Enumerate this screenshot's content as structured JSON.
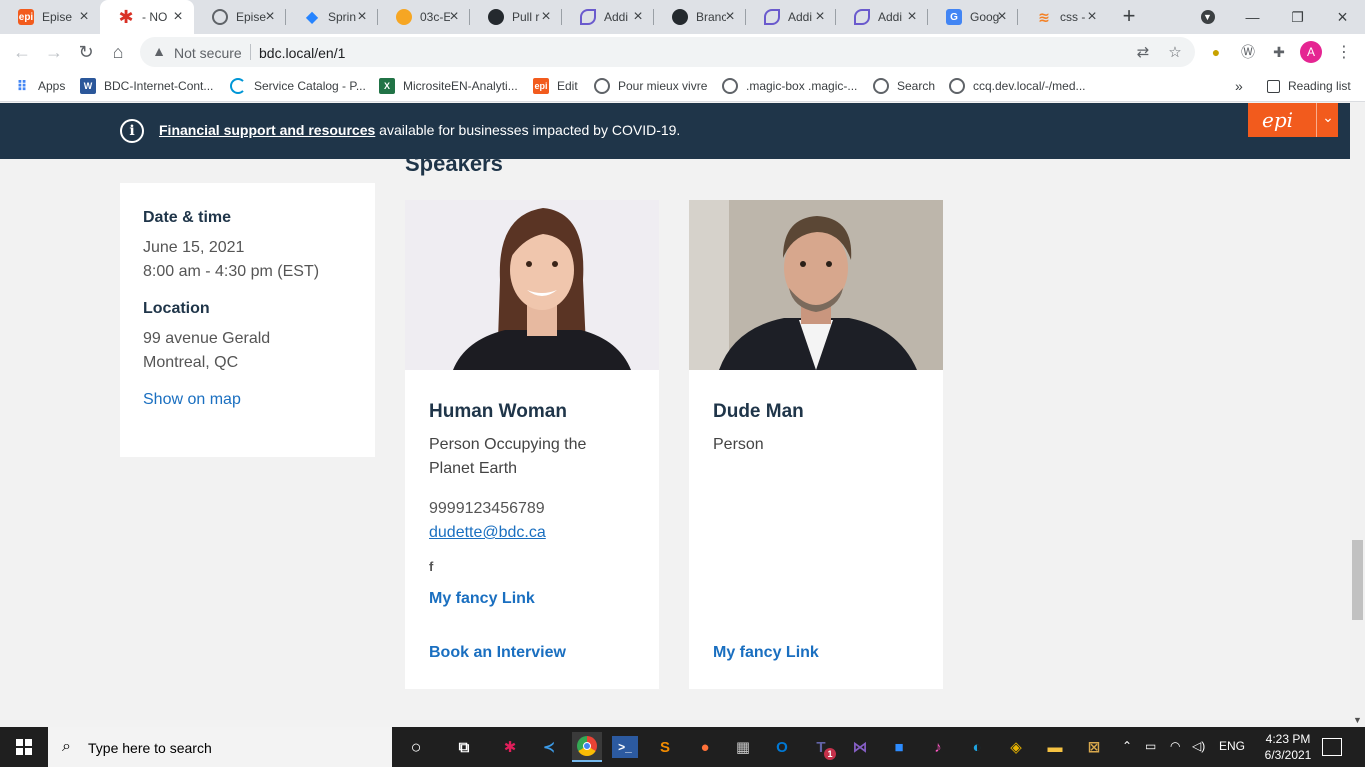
{
  "tabs": [
    {
      "label": "Epise",
      "fav_color": "#f25b1d",
      "fav_glyph": "epi"
    },
    {
      "label": "- NO",
      "fav_color": "#d93025",
      "fav_glyph": "*",
      "active": true
    },
    {
      "label": "Epise",
      "fav_color": "#5f6368",
      "fav_glyph": "globe"
    },
    {
      "label": "Sprin",
      "fav_color": "#2684ff",
      "fav_glyph": "diamond"
    },
    {
      "label": "03c-E",
      "fav_color": "#f6a623",
      "fav_glyph": "cloud"
    },
    {
      "label": "Pull r",
      "fav_color": "#24292e",
      "fav_glyph": "github"
    },
    {
      "label": "Addi",
      "fav_color": "#6a5acd",
      "fav_glyph": "swirl"
    },
    {
      "label": "Branc",
      "fav_color": "#24292e",
      "fav_glyph": "github"
    },
    {
      "label": "Addi",
      "fav_color": "#6a5acd",
      "fav_glyph": "swirl"
    },
    {
      "label": "Addi",
      "fav_color": "#6a5acd",
      "fav_glyph": "swirl"
    },
    {
      "label": "Goog",
      "fav_color": "#4285f4",
      "fav_glyph": "G"
    },
    {
      "label": "css -",
      "fav_color": "#f48024",
      "fav_glyph": "stack"
    }
  ],
  "toolbar": {
    "security_text": "Not secure",
    "url": "bdc.local/en/1",
    "avatar_letter": "A"
  },
  "bookmarks": [
    {
      "label": "Apps",
      "icon_color": "#4285f4",
      "glyph": "grid"
    },
    {
      "label": "BDC-Internet-Cont...",
      "icon_color": "#2b579a",
      "glyph": "W"
    },
    {
      "label": "Service Catalog - P...",
      "icon_color": "#0096d6",
      "glyph": "C"
    },
    {
      "label": "MicrositeEN-Analyti...",
      "icon_color": "#217346",
      "glyph": "X"
    },
    {
      "label": "Edit",
      "icon_color": "#f25b1d",
      "glyph": "epi"
    },
    {
      "label": "Pour mieux vivre",
      "icon_color": "#5f6368",
      "glyph": "globe"
    },
    {
      "label": ".magic-box .magic-...",
      "icon_color": "#5f6368",
      "glyph": "globe"
    },
    {
      "label": "Search",
      "icon_color": "#5f6368",
      "glyph": "globe"
    },
    {
      "label": "ccq.dev.local/-/med...",
      "icon_color": "#5f6368",
      "glyph": "globe"
    }
  ],
  "bookmarks_overflow": "»",
  "reading_list": "Reading list",
  "banner": {
    "link_text": "Financial support and resources",
    "rest_text": " available for businesses impacted by COVID-19."
  },
  "speakers_heading": "Speakers",
  "event": {
    "date_heading": "Date & time",
    "date": "June 15, 2021",
    "time": "8:00 am - 4:30 pm (EST)",
    "location_heading": "Location",
    "address_line1": "99 avenue Gerald",
    "address_line2": "Montreal, QC",
    "map_link": "Show on map"
  },
  "speakers": [
    {
      "name": "Human Woman",
      "title": "Person Occupying the Planet Earth",
      "phone": "9999123456789",
      "email": "dudette@bdc.ca",
      "social_icon": "f",
      "fancy_link": "My fancy Link",
      "book_link": "Book an Interview"
    },
    {
      "name": "Dude Man",
      "title": "Person",
      "fancy_link": "My fancy Link"
    }
  ],
  "taskbar": {
    "search_placeholder": "Type here to search",
    "language": "ENG",
    "time": "4:23 PM",
    "date": "6/3/2021",
    "teams_badge": "1"
  }
}
